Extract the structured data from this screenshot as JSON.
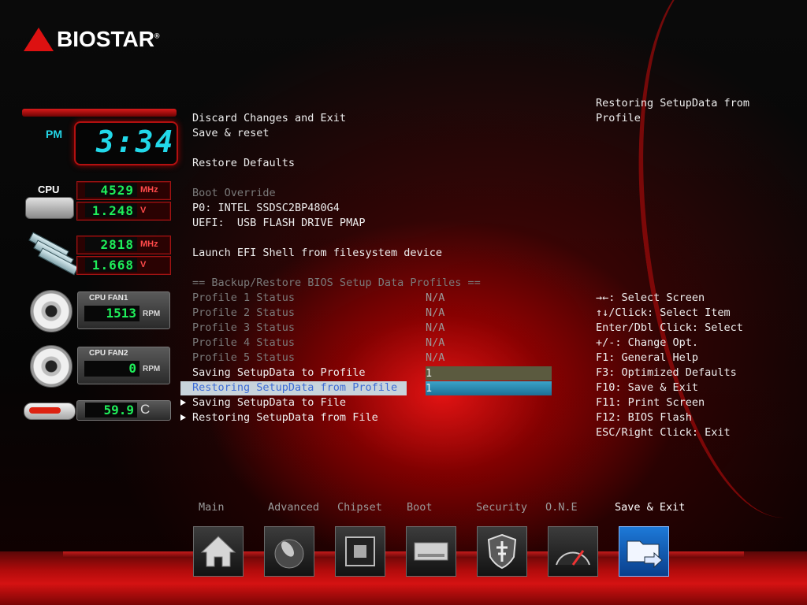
{
  "brand": {
    "name": "BIOSTAR",
    "mark": "®"
  },
  "clock": {
    "ampm": "PM",
    "time": "3:34"
  },
  "hardware": {
    "cpu": {
      "label": "CPU",
      "frequency": "4529",
      "frequency_unit": "MHz",
      "voltage": "1.248",
      "voltage_unit": "V"
    },
    "memory": {
      "frequency": "2818",
      "frequency_unit": "MHz",
      "voltage": "1.668",
      "voltage_unit": "V"
    },
    "fan1": {
      "label": "CPU FAN1",
      "value": "1513",
      "unit": "RPM"
    },
    "fan2": {
      "label": "CPU FAN2",
      "value": "0",
      "unit": "RPM"
    },
    "temperature": {
      "value": "59.9",
      "unit": "C"
    }
  },
  "menu": {
    "discard_exit": "Discard Changes and Exit",
    "save_reset": "Save & reset",
    "restore_defaults": "Restore Defaults",
    "boot_override": "Boot Override",
    "boot_p0": "P0: INTEL SSDSC2BP480G4",
    "boot_uefi": "UEFI:  USB FLASH DRIVE PMAP",
    "launch_efi": "Launch EFI Shell from filesystem device",
    "profiles_header": "== Backup/Restore BIOS Setup Data Profiles ==",
    "profiles": [
      {
        "label": "Profile 1 Status",
        "value": "N/A"
      },
      {
        "label": "Profile 2 Status",
        "value": "N/A"
      },
      {
        "label": "Profile 3 Status",
        "value": "N/A"
      },
      {
        "label": "Profile 4 Status",
        "value": "N/A"
      },
      {
        "label": "Profile 5 Status",
        "value": "N/A"
      }
    ],
    "saving_profile": {
      "label": "Saving SetupData to Profile",
      "value": "1"
    },
    "restoring_profile": {
      "label": "Restoring SetupData from Profile",
      "value": "1"
    },
    "saving_file": "Saving SetupData to File",
    "restoring_file": "Restoring SetupData from File"
  },
  "help": {
    "description": "Restoring SetupData from Profile",
    "keys": [
      "→←: Select Screen",
      "↑↓/Click: Select Item",
      "Enter/Dbl Click: Select",
      "+/-: Change Opt.",
      "F1: General Help",
      "F3: Optimized Defaults",
      "F10: Save & Exit",
      "F11: Print Screen",
      "F12: BIOS Flash",
      "ESC/Right Click: Exit"
    ]
  },
  "tabs": [
    {
      "label": "Main",
      "icon": "home-icon",
      "active": false
    },
    {
      "label": "Advanced",
      "icon": "joystick-icon",
      "active": false
    },
    {
      "label": "Chipset",
      "icon": "chip-icon",
      "active": false
    },
    {
      "label": "Boot",
      "icon": "drive-icon",
      "active": false
    },
    {
      "label": "Security",
      "icon": "shield-icon",
      "active": false
    },
    {
      "label": "O.N.E",
      "icon": "gauge-icon",
      "active": false
    },
    {
      "label": "Save & Exit",
      "icon": "folder-exit-icon",
      "active": true
    }
  ],
  "colors": {
    "accent": "#d11111",
    "lcd_green": "#1fef5a",
    "clock_cyan": "#22d9ea",
    "selection_blue": "#2a8ab5"
  }
}
